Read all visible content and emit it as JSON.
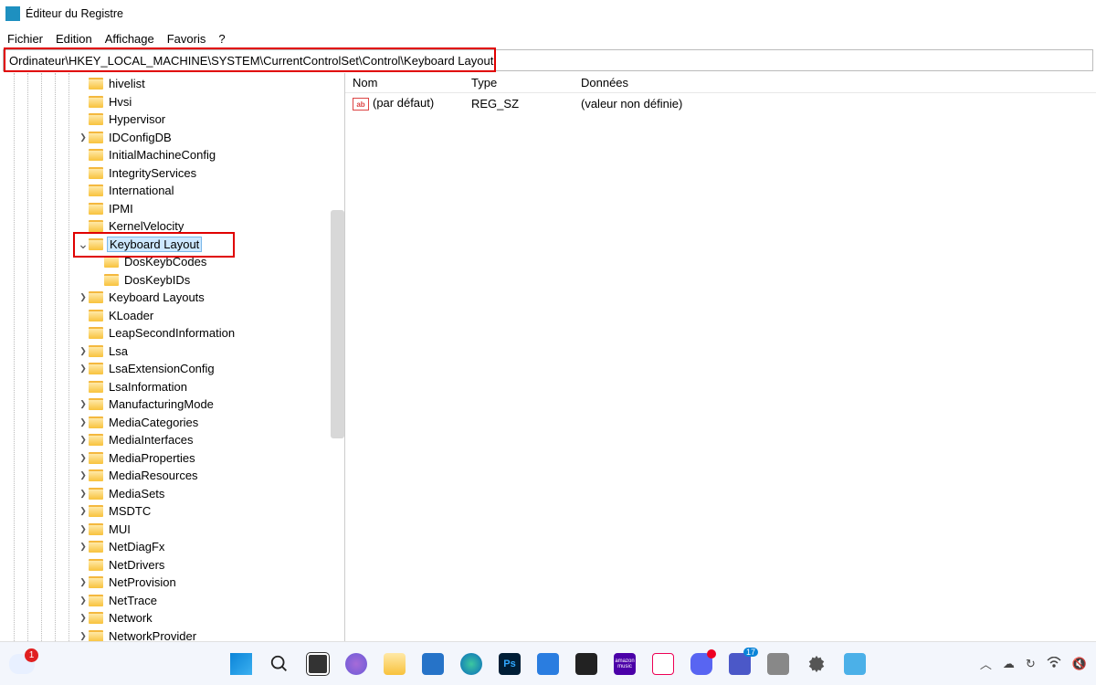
{
  "window": {
    "title": "Éditeur du Registre"
  },
  "menu": {
    "items": [
      "Fichier",
      "Edition",
      "Affichage",
      "Favoris",
      "?"
    ]
  },
  "path": "Ordinateur\\HKEY_LOCAL_MACHINE\\SYSTEM\\CurrentControlSet\\Control\\Keyboard Layout",
  "tree": {
    "items": [
      {
        "label": "hivelist",
        "indent": 5,
        "chev": ""
      },
      {
        "label": "Hvsi",
        "indent": 5,
        "chev": ""
      },
      {
        "label": "Hypervisor",
        "indent": 5,
        "chev": ""
      },
      {
        "label": "IDConfigDB",
        "indent": 5,
        "chev": ">"
      },
      {
        "label": "InitialMachineConfig",
        "indent": 5,
        "chev": ""
      },
      {
        "label": "IntegrityServices",
        "indent": 5,
        "chev": ""
      },
      {
        "label": "International",
        "indent": 5,
        "chev": ""
      },
      {
        "label": "IPMI",
        "indent": 5,
        "chev": ""
      },
      {
        "label": "KernelVelocity",
        "indent": 5,
        "chev": ""
      },
      {
        "label": "Keyboard Layout",
        "indent": 5,
        "chev": "v",
        "selected": true
      },
      {
        "label": "DosKeybCodes",
        "indent": 6,
        "chev": ""
      },
      {
        "label": "DosKeybIDs",
        "indent": 6,
        "chev": ""
      },
      {
        "label": "Keyboard Layouts",
        "indent": 5,
        "chev": ">"
      },
      {
        "label": "KLoader",
        "indent": 5,
        "chev": ""
      },
      {
        "label": "LeapSecondInformation",
        "indent": 5,
        "chev": ""
      },
      {
        "label": "Lsa",
        "indent": 5,
        "chev": ">"
      },
      {
        "label": "LsaExtensionConfig",
        "indent": 5,
        "chev": ">"
      },
      {
        "label": "LsaInformation",
        "indent": 5,
        "chev": ""
      },
      {
        "label": "ManufacturingMode",
        "indent": 5,
        "chev": ">"
      },
      {
        "label": "MediaCategories",
        "indent": 5,
        "chev": ">"
      },
      {
        "label": "MediaInterfaces",
        "indent": 5,
        "chev": ">"
      },
      {
        "label": "MediaProperties",
        "indent": 5,
        "chev": ">"
      },
      {
        "label": "MediaResources",
        "indent": 5,
        "chev": ">"
      },
      {
        "label": "MediaSets",
        "indent": 5,
        "chev": ">"
      },
      {
        "label": "MSDTC",
        "indent": 5,
        "chev": ">"
      },
      {
        "label": "MUI",
        "indent": 5,
        "chev": ">"
      },
      {
        "label": "NetDiagFx",
        "indent": 5,
        "chev": ">"
      },
      {
        "label": "NetDrivers",
        "indent": 5,
        "chev": ""
      },
      {
        "label": "NetProvision",
        "indent": 5,
        "chev": ">"
      },
      {
        "label": "NetTrace",
        "indent": 5,
        "chev": ">"
      },
      {
        "label": "Network",
        "indent": 5,
        "chev": ">"
      },
      {
        "label": "NetworkProvider",
        "indent": 5,
        "chev": ">"
      }
    ]
  },
  "values": {
    "columns": {
      "name": "Nom",
      "type": "Type",
      "data": "Données"
    },
    "rows": [
      {
        "name": "(par défaut)",
        "type": "REG_SZ",
        "data": "(valeur non définie)"
      }
    ]
  },
  "taskbar": {
    "cloud_badge": "1",
    "teams_badge": "17",
    "icons": [
      "start",
      "search",
      "taskview",
      "chat",
      "explorer",
      "store",
      "edge",
      "photoshop",
      "3d",
      "play",
      "amazon-music",
      "snip",
      "discord",
      "teams",
      "app1",
      "settings",
      "app2"
    ]
  }
}
